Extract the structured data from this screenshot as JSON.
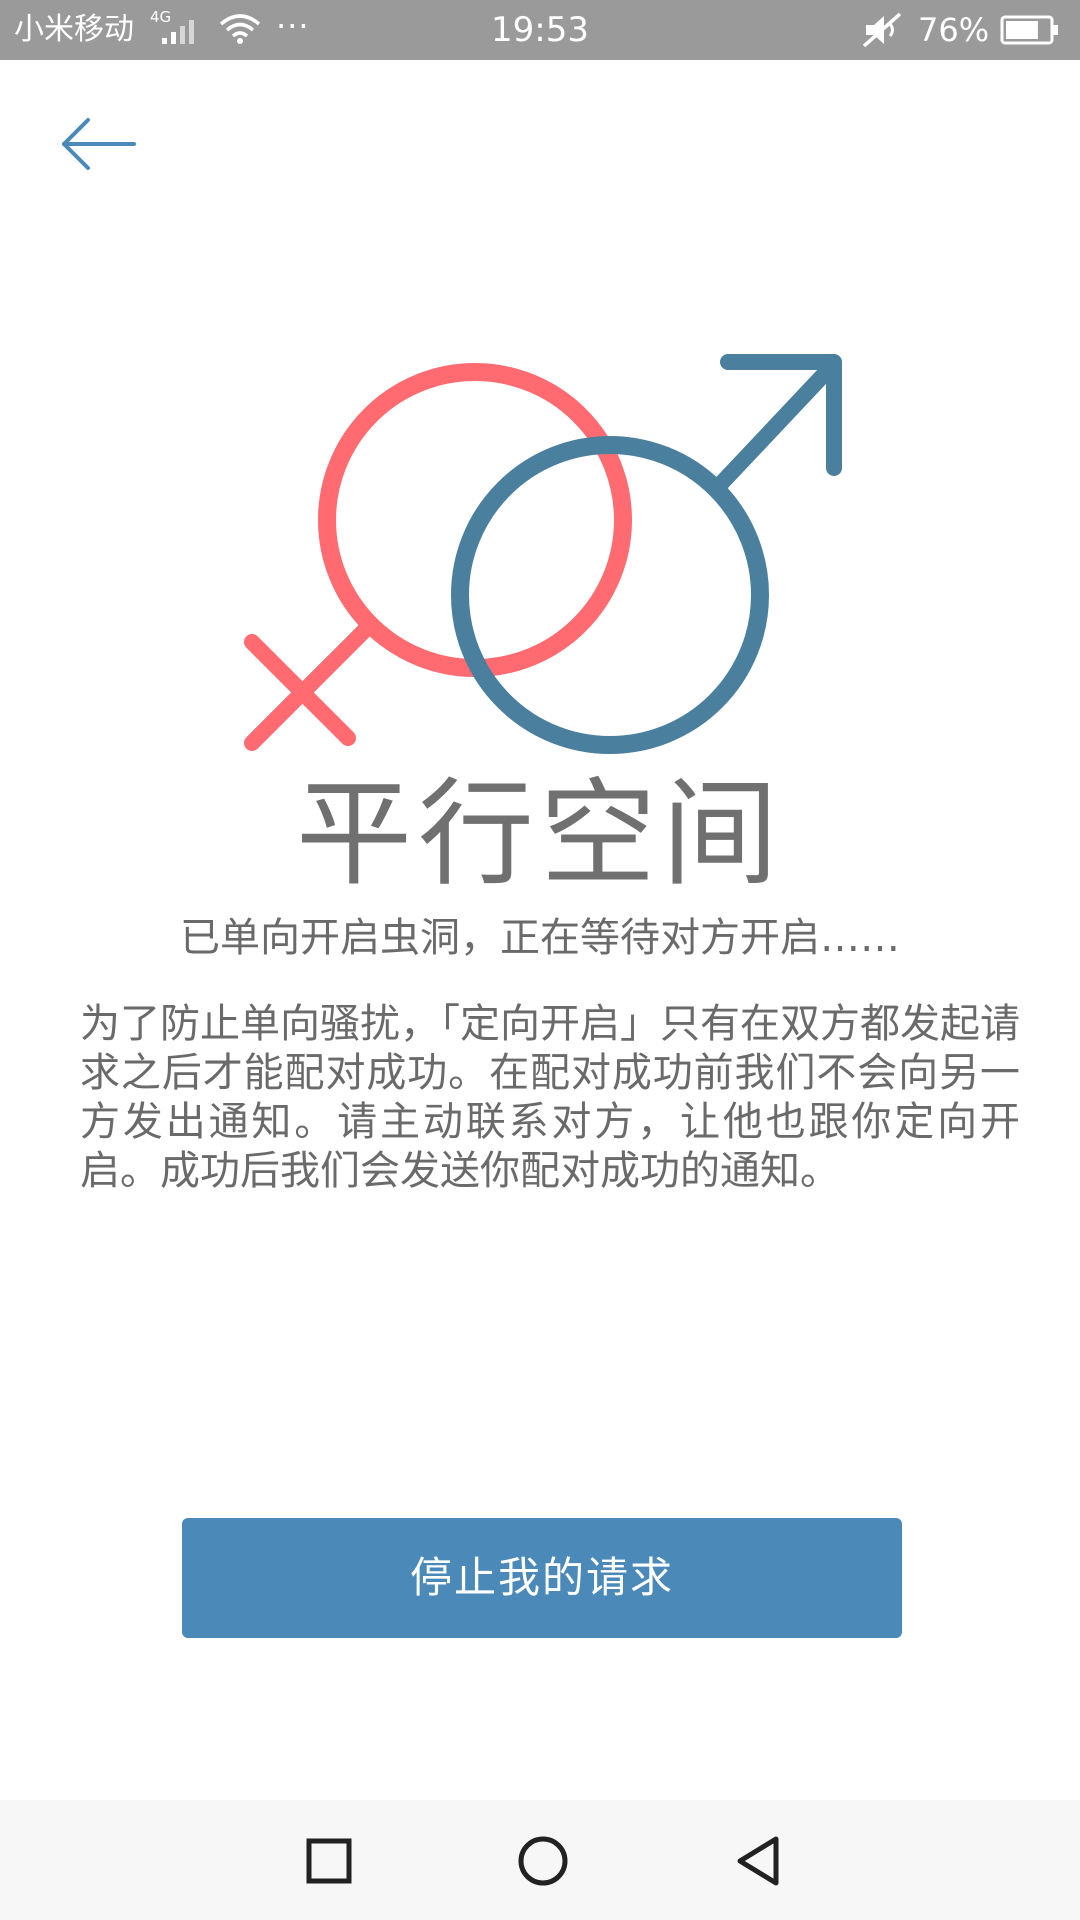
{
  "status_bar": {
    "carrier": "小米移动",
    "network_type": "4G",
    "more": "···",
    "time": "19:53",
    "battery_percent": "76%",
    "battery_level": 0.76
  },
  "header": {
    "back_icon": "arrow-left-icon"
  },
  "logo": {
    "icon": "female-male-symbols-icon",
    "female_color": "#ff6b70",
    "male_color": "#4a7f9e"
  },
  "main": {
    "title": "平行空间",
    "status": "已单向开启虫洞，正在等待对方开启……",
    "description": "为了防止单向骚扰，「定向开启」只有在双方都发起请求之后才能配对成功。在配对成功前我们不会向另一方发出通知。请主动联系对方，让他也跟你定向开启。成功后我们会发送你配对成功的通知。"
  },
  "actions": {
    "stop_label": "停止我的请求",
    "button_color": "#4a89b8"
  },
  "nav": {
    "recent_icon": "square-icon",
    "home_icon": "circle-icon",
    "back_icon": "triangle-back-icon"
  }
}
